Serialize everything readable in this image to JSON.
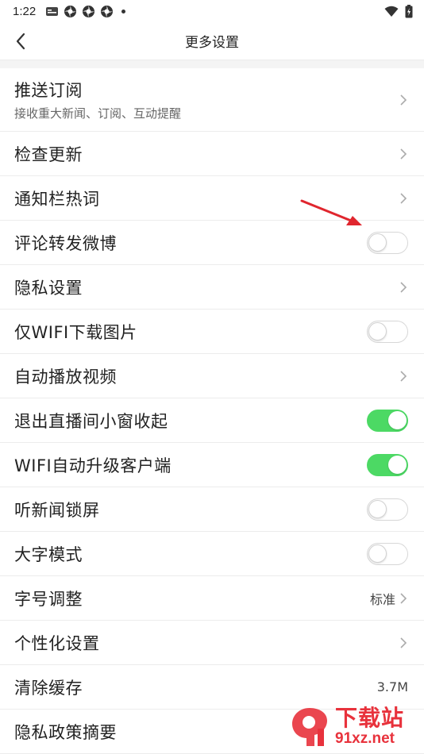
{
  "status_bar": {
    "time": "1:22",
    "icons": [
      "news-app-icon",
      "aperture-icon",
      "aperture-icon",
      "aperture-icon",
      "dot-icon"
    ],
    "right_icons": [
      "wifi-icon",
      "battery-icon"
    ]
  },
  "header": {
    "title": "更多设置",
    "back_icon": "chevron-left-icon"
  },
  "settings": {
    "push": {
      "label": "推送订阅",
      "sub": "接收重大新闻、订阅、互动提醒"
    },
    "update": {
      "label": "检查更新"
    },
    "notify_hot": {
      "label": "通知栏热词"
    },
    "weibo": {
      "label": "评论转发微博",
      "on": false
    },
    "privacy": {
      "label": "隐私设置"
    },
    "wifi_images": {
      "label": "仅WIFI下载图片",
      "on": false
    },
    "autoplay": {
      "label": "自动播放视频"
    },
    "live_window": {
      "label": "退出直播间小窗收起",
      "on": true
    },
    "wifi_upgrade": {
      "label": "WIFI自动升级客户端",
      "on": true
    },
    "lock_screen": {
      "label": "听新闻锁屏",
      "on": false
    },
    "big_font": {
      "label": "大字模式",
      "on": false
    },
    "font_size": {
      "label": "字号调整",
      "value": "标准"
    },
    "personalize": {
      "label": "个性化设置"
    },
    "cache": {
      "label": "清除缓存",
      "value": "3.7M"
    },
    "policy": {
      "label": "隐私政策摘要"
    }
  },
  "colors": {
    "toggle_on": "#4cd964",
    "annotation_arrow": "#e0262e",
    "watermark": "#e8323c"
  },
  "watermark": {
    "title": "下载站",
    "domain": "91xz.net"
  }
}
